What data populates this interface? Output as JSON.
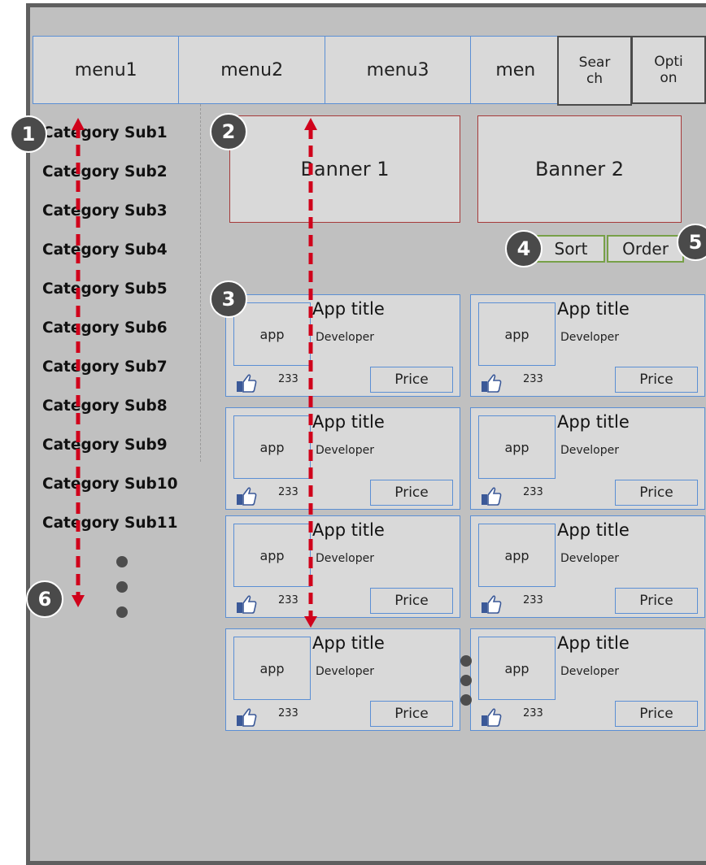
{
  "menu": {
    "items": [
      "menu1",
      "menu2",
      "menu3",
      "men"
    ],
    "search_label": "Search",
    "option_label": "Option"
  },
  "sidebar": {
    "categories": [
      "Category Sub1",
      "Category Sub2",
      "Category Sub3",
      "Category Sub4",
      "Category Sub5",
      "Category Sub6",
      "Category Sub7",
      "Category Sub8",
      "Category Sub9",
      "Category Sub10",
      "Category Sub11"
    ]
  },
  "banners": [
    "Banner 1",
    "Banner 2"
  ],
  "controls": {
    "sort_label": "Sort",
    "order_label": "Order"
  },
  "apps": {
    "thumb_label": "app",
    "title": "App title",
    "developer": "Developer",
    "likes": "233",
    "price_label": "Price",
    "rows": 4,
    "columns": 2
  },
  "markers": [
    "1",
    "2",
    "3",
    "4",
    "5",
    "6"
  ],
  "colors": {
    "frame_bg": "#c0c0c0",
    "panel_bg": "#d9d9d9",
    "card_border": "#5b8fd4",
    "banner_border": "#a63a3a",
    "sort_border": "#77a048",
    "arrow": "#d0021b",
    "marker_bg": "#4a4a4a"
  },
  "icons": {
    "like": "thumbs-up-icon",
    "scroll": "double-arrow-scroll-icon"
  }
}
